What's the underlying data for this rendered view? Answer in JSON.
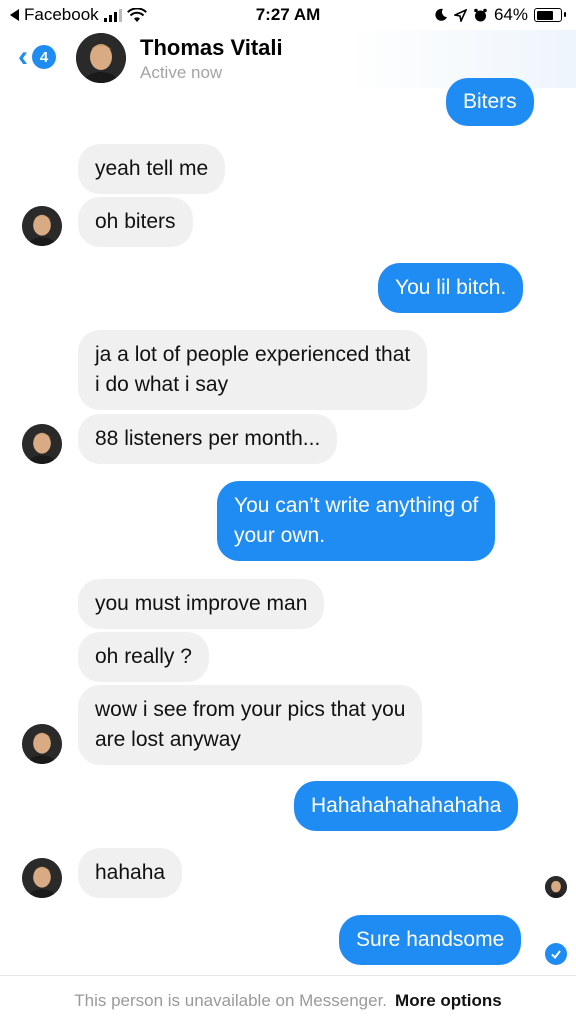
{
  "status_bar": {
    "back_app": "Facebook",
    "time": "7:27 AM",
    "battery": "64%",
    "battery_level": 0.64
  },
  "header": {
    "badge_count": "4",
    "name": "Thomas Vitali",
    "status": "Active now"
  },
  "messages": [
    {
      "side": "out",
      "text": "Biters"
    },
    {
      "side": "in",
      "text": "yeah tell me"
    },
    {
      "side": "in",
      "text": "oh biters"
    },
    {
      "side": "out",
      "text": "You lil bitch."
    },
    {
      "side": "in",
      "text_lines": [
        "ja a lot of people experienced that",
        "i do what i say"
      ]
    },
    {
      "side": "in",
      "text": "88 listeners per month..."
    },
    {
      "side": "out",
      "text_lines": [
        "You can’t write anything of",
        "your own."
      ]
    },
    {
      "side": "in",
      "text": "you must improve man"
    },
    {
      "side": "in",
      "text": "oh really ?"
    },
    {
      "side": "in",
      "text_lines": [
        "wow i see from your pics that you",
        "are lost anyway"
      ]
    },
    {
      "side": "out",
      "text": "Hahahahahahahaha"
    },
    {
      "side": "in",
      "text": "hahaha"
    },
    {
      "side": "out",
      "text": "Sure handsome"
    }
  ],
  "footer": {
    "notice": "This person is unavailable on Messenger.",
    "link": "More options"
  },
  "colors": {
    "accent": "#1e8cf3",
    "incoming_bubble": "#f0f0f0",
    "muted": "#a4a4a4"
  }
}
